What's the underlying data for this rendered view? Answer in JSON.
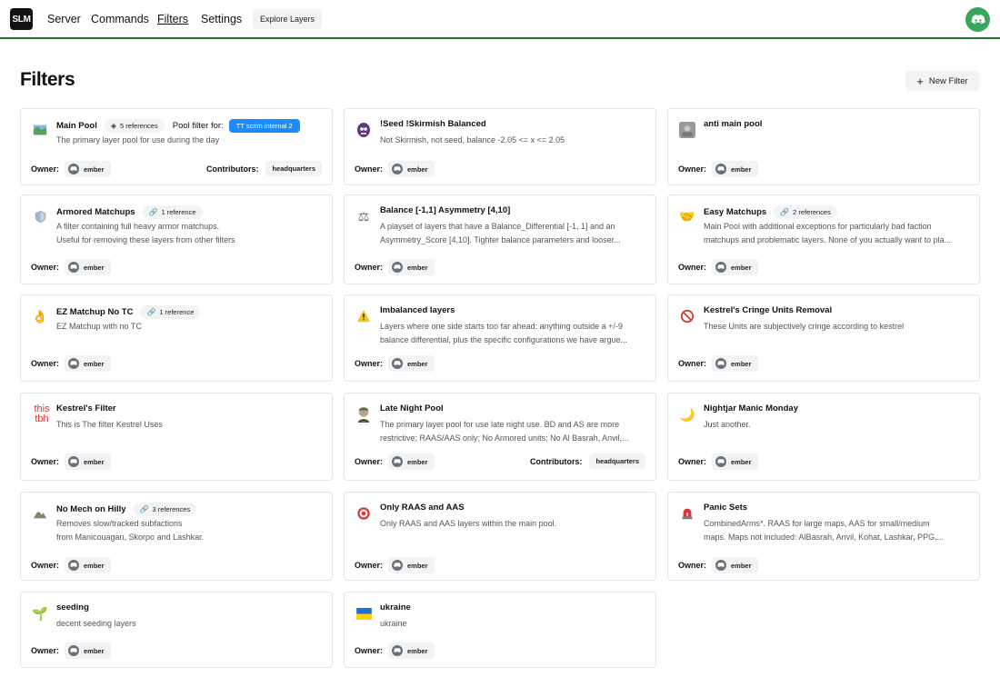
{
  "nav": {
    "logo": "SLM",
    "items": [
      "Server",
      "Commands",
      "Filters",
      "Settings"
    ],
    "explore": "Explore Layers"
  },
  "page": {
    "title": "Filters",
    "new_filter": "New Filter"
  },
  "labels": {
    "owner": "Owner:",
    "contributors": "Contributors:",
    "pool_filter_for": "Pool filter for:"
  },
  "colors": {
    "accent_green": "#1e7a33",
    "discord_green": "#3ba55c",
    "tag_blue": "#1a8cff"
  },
  "cards": [
    {
      "name": "Main Pool",
      "icon": "map-icon",
      "refs": "5 references",
      "pool_tag": "TT scrim internal 2",
      "desc": [
        "The primary layer pool for use during the day"
      ],
      "owner": "ember",
      "contributor": "headquarters"
    },
    {
      "name": "!Seed !Skirmish Balanced",
      "icon": "skull-icon",
      "desc": [
        "Not Skirmish, not seed, balance -2.05 <= x <= 2.05"
      ],
      "owner": "ember"
    },
    {
      "name": "anti main pool",
      "icon": "photo-avatar-icon",
      "desc": [],
      "owner": "ember"
    },
    {
      "name": "Armored Matchups",
      "icon": "shield-icon",
      "refs": "1 reference",
      "desc": [
        "A filter containing full heavy armor matchups.",
        "Useful for removing these layers from other filters"
      ],
      "owner": "ember"
    },
    {
      "name": "Balance [-1,1] Asymmetry [4,10]",
      "icon": "scales-icon",
      "desc": [
        "A playset of layers that have a Balance_Differential [-1, 1] and an",
        "Asymmetry_Score [4,10]. Tighter balance parameters and looser..."
      ],
      "owner": "ember"
    },
    {
      "name": "Easy Matchups",
      "icon": "handshake-icon",
      "refs": "2 references",
      "desc": [
        "Main Pool with additional exceptions for particularly bad faction",
        "matchups and problematic layers. None of you actually want to pla..."
      ],
      "owner": "ember"
    },
    {
      "name": "EZ Matchup No TC",
      "icon": "ok-hand-icon",
      "refs": "1 reference",
      "desc": [
        "EZ Matchup with no TC"
      ],
      "owner": "ember"
    },
    {
      "name": "Imbalanced layers",
      "icon": "warning-icon",
      "desc": [
        "Layers where one side starts too far ahead: anything outside a +/-9",
        "balance differential, plus the specific configurations we have argue..."
      ],
      "owner": "ember"
    },
    {
      "name": "Kestrel's Cringe Units Removal",
      "icon": "prohibited-icon",
      "desc": [
        "These Units are subjectively cringe according to kestrel"
      ],
      "owner": "ember"
    },
    {
      "name": "Kestrel's Filter",
      "icon": "text-logo-icon",
      "icon_text": [
        "this",
        "tbh"
      ],
      "desc": [
        "This is The filter Kestrel Uses"
      ],
      "owner": "ember"
    },
    {
      "name": "Late Night Pool",
      "icon": "soldier-icon",
      "desc": [
        "The primary layer pool for use late night use. BD and AS are more",
        "restrictive; RAAS/AAS only; No Armored units; No Al Basrah, Anvil,..."
      ],
      "owner": "ember",
      "contributor": "headquarters"
    },
    {
      "name": "Nightjar Manic Monday",
      "icon": "moon-icon",
      "desc": [
        "Just another."
      ],
      "owner": "ember"
    },
    {
      "name": "No Mech on Hilly",
      "icon": "mountain-icon",
      "refs": "3 references",
      "desc": [
        "Removes slow/tracked subfactions",
        "from Manicouagan, Skorpo and Lashkar."
      ],
      "owner": "ember"
    },
    {
      "name": "Only RAAS and AAS",
      "icon": "target-icon",
      "desc": [
        "Only RAAS and AAS layers within the main pool."
      ],
      "owner": "ember"
    },
    {
      "name": "Panic Sets",
      "icon": "siren-icon",
      "desc": [
        "CombinedArms*. RAAS for large maps, AAS for small/medium",
        "maps. Maps not included: AlBasrah, Anvil, Kohat, Lashkar, PPG,..."
      ],
      "owner": "ember"
    },
    {
      "name": "seeding",
      "icon": "seedling-icon",
      "desc": [
        "decent seeding layers"
      ],
      "owner": "ember"
    },
    {
      "name": "ukraine",
      "icon": "ukraine-flag-icon",
      "desc": [
        "ukraine"
      ],
      "owner": "ember"
    }
  ]
}
